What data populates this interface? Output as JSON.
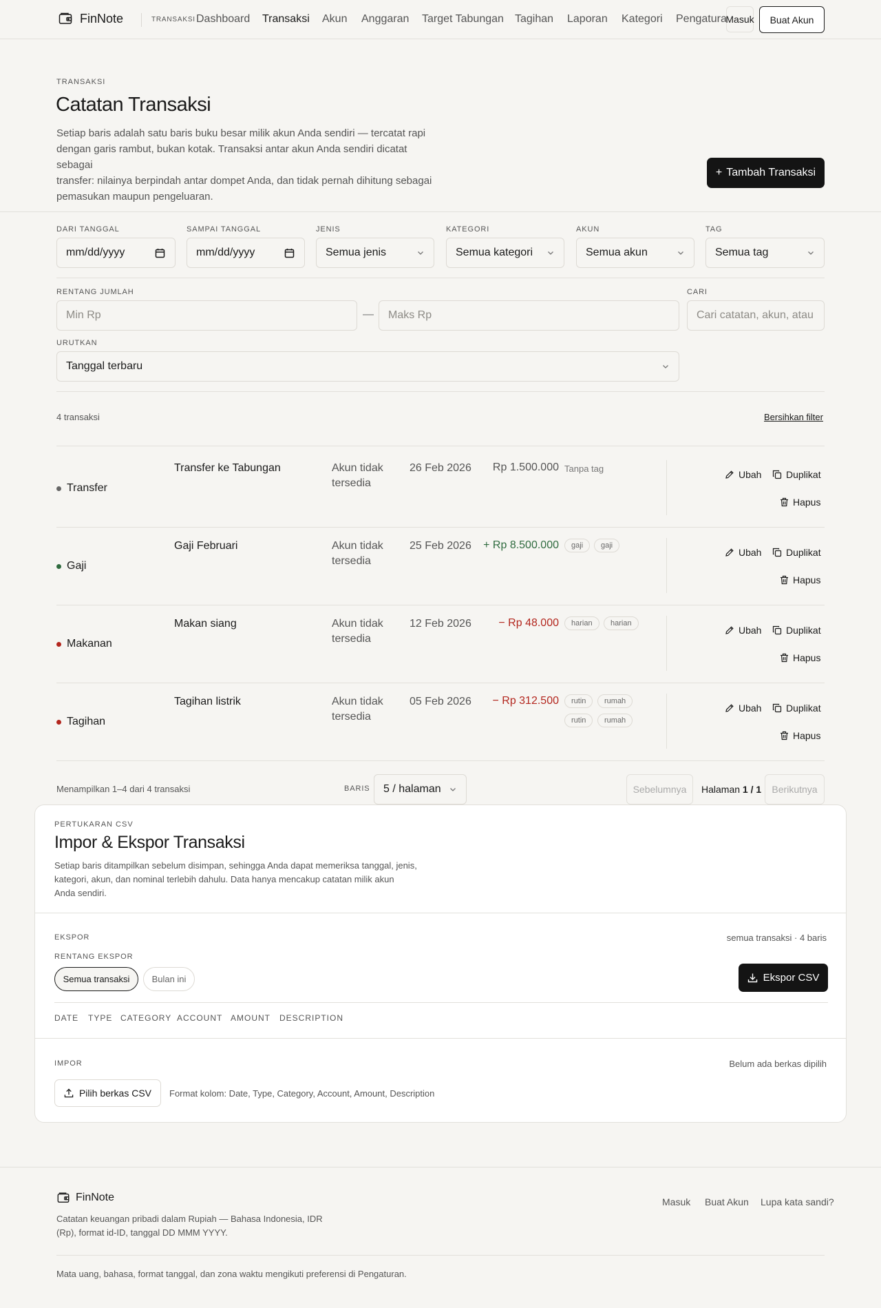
{
  "app": {
    "name": "FinNote"
  },
  "header": {
    "breadcrumb": "TRANSAKSI",
    "nav": [
      "Dashboard",
      "Transaksi",
      "Akun",
      "Anggaran",
      "Target Tabungan",
      "Tagihan",
      "Laporan",
      "Kategori",
      "Pengaturan"
    ],
    "login": "Masuk",
    "signup": "Buat Akun"
  },
  "hero": {
    "eyebrow": "TRANSAKSI",
    "title": "Catatan Transaksi",
    "lines": [
      "Setiap baris adalah satu baris buku besar milik akun Anda sendiri — tercatat rapi",
      "dengan garis rambut, bukan kotak. Transaksi antar akun Anda sendiri dicatat sebagai",
      "transfer: nilainya berpindah antar dompet Anda, dan tidak pernah dihitung sebagai",
      "pemasukan maupun pengeluaran."
    ],
    "add_button": "Tambah Transaksi"
  },
  "filters": {
    "from_label": "DARI TANGGAL",
    "from_value": "mm/dd/yyyy",
    "to_label": "SAMPAI TANGGAL",
    "to_value": "mm/dd/yyyy",
    "type_label": "JENIS",
    "type_value": "Semua jenis",
    "category_label": "KATEGORI",
    "category_value": "Semua kategori",
    "account_label": "AKUN",
    "account_value": "Semua akun",
    "tag_label": "TAG",
    "tag_value": "Semua tag",
    "range_label": "RENTANG JUMLAH",
    "min_placeholder": "Min Rp",
    "range_sep": "—",
    "max_placeholder": "Maks Rp",
    "search_label": "CARI",
    "search_placeholder": "Cari catatan, akun, atau",
    "sort_label": "URUTKAN",
    "sort_value": "Tanggal terbaru"
  },
  "summary": {
    "count": "4 transaksi",
    "clear": "Bersihkan filter"
  },
  "actions": {
    "edit": "Ubah",
    "duplicate": "Duplikat",
    "delete": "Hapus"
  },
  "transactions": [
    {
      "category": "Transfer",
      "dot": "#666666",
      "desc": "Transfer ke Tabungan",
      "acct1": "Akun tidak",
      "acct2": "tersedia",
      "date": "26 Feb 2026",
      "amount": "Rp 1.500.000",
      "notag": "Tanpa tag",
      "tags": []
    },
    {
      "category": "Gaji",
      "dot": "#2f6b3f",
      "desc": "Gaji Februari",
      "acct1": "Akun tidak",
      "acct2": "tersedia",
      "date": "25 Feb 2026",
      "amount": "+ Rp 8.500.000",
      "tags": [
        "gaji",
        "gaji"
      ]
    },
    {
      "category": "Makanan",
      "dot": "#b3261e",
      "desc": "Makan siang",
      "acct1": "Akun tidak",
      "acct2": "tersedia",
      "date": "12 Feb 2026",
      "amount": "− Rp 48.000",
      "tags": [
        "harian",
        "harian"
      ]
    },
    {
      "category": "Tagihan",
      "dot": "#b3261e",
      "desc": "Tagihan listrik",
      "acct1": "Akun tidak",
      "acct2": "tersedia",
      "date": "05 Feb 2026",
      "amount": "− Rp 312.500",
      "tags": [
        "rutin",
        "rumah",
        "rutin",
        "rumah"
      ]
    }
  ],
  "pagination": {
    "showing": "Menampilkan 1–4 dari 4 transaksi",
    "rows_label": "BARIS",
    "rows_value": "5 / halaman",
    "prev": "Sebelumnya",
    "page_prefix": "Halaman",
    "page_current": "1 / 1",
    "next": "Berikutnya"
  },
  "csv": {
    "eyebrow": "PERTUKARAN CSV",
    "title": "Impor & Ekspor Transaksi",
    "lines": [
      "Setiap baris ditampilkan sebelum disimpan, sehingga Anda dapat memeriksa tanggal, jenis,",
      "kategori, akun, dan nominal terlebih dahulu. Data hanya mencakup catatan milik akun",
      "Anda sendiri."
    ],
    "export_label": "EKSPOR",
    "export_meta": "semua transaksi · 4 baris",
    "range_label": "RENTANG EKSPOR",
    "range_all": "Semua transaksi",
    "range_month": "Bulan ini",
    "export_button": "Ekspor CSV",
    "columns": [
      "DATE",
      "TYPE",
      "CATEGORY",
      "ACCOUNT",
      "AMOUNT",
      "DESCRIPTION"
    ],
    "import_label": "IMPOR",
    "import_status": "Belum ada berkas dipilih",
    "pick_button": "Pilih berkas CSV",
    "format_note": "Format kolom: Date, Type, Category, Account, Amount, Description"
  },
  "footer": {
    "brand": "FinNote",
    "line1": "Catatan keuangan pribadi dalam Rupiah — Bahasa Indonesia, IDR",
    "line2": "(Rp), format id-ID, tanggal DD MMM YYYY.",
    "links": [
      "Masuk",
      "Buat Akun",
      "Lupa kata sandi?"
    ],
    "note": "Mata uang, bahasa, format tanggal, dan zona waktu mengikuti preferensi di Pengaturan."
  }
}
